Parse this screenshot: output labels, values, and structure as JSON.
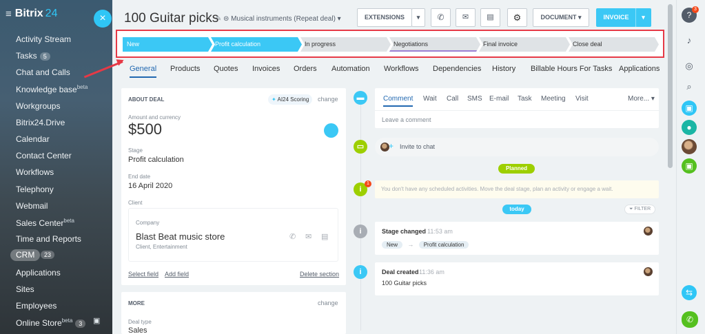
{
  "sidebar": {
    "logo_name": "Bitrix",
    "logo_num": "24",
    "items": [
      {
        "label": "Activity Stream"
      },
      {
        "label": "Tasks",
        "counter": "5"
      },
      {
        "label": "Chat and Calls"
      },
      {
        "label": "Knowledge base",
        "sup": "beta"
      },
      {
        "label": "Workgroups"
      },
      {
        "label": "Bitrix24.Drive"
      },
      {
        "label": "Calendar"
      },
      {
        "label": "Contact Center"
      },
      {
        "label": "Workflows"
      },
      {
        "label": "Telephony"
      },
      {
        "label": "Webmail"
      },
      {
        "label": "Sales Center",
        "sup": "beta"
      },
      {
        "label": "Time and Reports"
      },
      {
        "label": "CRM",
        "counter": "23"
      },
      {
        "label": "Applications"
      },
      {
        "label": "Sites"
      },
      {
        "label": "Employees"
      },
      {
        "label": "Online Store",
        "sup": "beta",
        "counter": "3"
      }
    ]
  },
  "header": {
    "title": "100 Guitar  picks",
    "pipeline": "Musical instruments (Repeat deal)",
    "extensions_label": "EXTENSIONS",
    "document_label": "DOCUMENT",
    "invoice_label": "INVOICE"
  },
  "stages": [
    "New",
    "Profit calculation",
    "In progress",
    "Negotiations",
    "Final invoice",
    "Close deal"
  ],
  "tabs": [
    "General",
    "Products",
    "Quotes",
    "Invoices",
    "Orders",
    "Automation",
    "Workflows",
    "Dependencies",
    "History",
    "Billable Hours For Tasks",
    "Applications"
  ],
  "about": {
    "section_title": "ABOUT DEAL",
    "scoring": "AI24 Scoring",
    "change": "change",
    "amount_label": "Amount and currency",
    "amount": "$500",
    "stage_label": "Stage",
    "stage_value": "Profit calculation",
    "end_label": "End date",
    "end_value": "16 April 2020",
    "client_label": "Client",
    "company_label": "Company",
    "company_name": "Blast Beat music store",
    "company_sub": "Client, Entertainment",
    "select_field": "Select field",
    "add_field": "Add field",
    "delete_section": "Delete section"
  },
  "more": {
    "section_title": "MORE",
    "change": "change",
    "deal_type_label": "Deal type",
    "deal_type_value": "Sales"
  },
  "activity": {
    "tabs": [
      "Comment",
      "Wait",
      "Call",
      "SMS",
      "E-mail",
      "Task",
      "Meeting",
      "Visit"
    ],
    "more": "More...",
    "placeholder": "Leave a comment",
    "invite": "Invite to chat",
    "planned": "Planned",
    "no_activities": "You don't have any scheduled activities. Move the deal stage, plan an activity or engage a wait.",
    "today": "today",
    "filter": "FILTER",
    "ev1_title": "Stage changed",
    "ev1_time": "11:53 am",
    "ev1_from": "New",
    "ev1_to": "Profit calculation",
    "ev2_title": "Deal created",
    "ev2_time": "11:36 am",
    "ev2_body": "100 Guitar picks",
    "notif_count": "1"
  },
  "rightbar": {
    "help_count": "3"
  },
  "colors": {
    "accent": "#3bc8f5",
    "highlight_box": "#e63946",
    "planned_green": "#9dcf00"
  }
}
